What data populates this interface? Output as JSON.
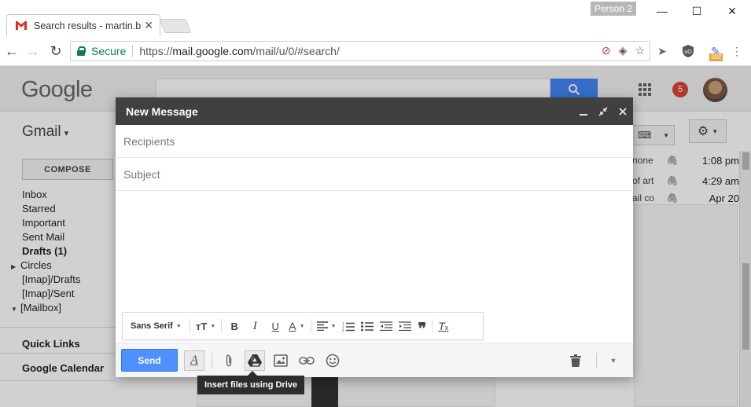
{
  "browser": {
    "tab_title": "Search results - martin.b",
    "person_label": "Person 2",
    "secure_label": "Secure",
    "url_scheme": "https://",
    "url_host": "mail.google.com",
    "url_path": "/mail/u/0/#search/",
    "extension_badge": "302"
  },
  "gmail": {
    "logo": "Google",
    "label": "Gmail",
    "compose_label": "COMPOSE",
    "notification_count": "5",
    "sidebar": [
      "Inbox",
      "Starred",
      "Important",
      "Sent Mail",
      "Drafts (1)",
      "Circles",
      "[Imap]/Drafts",
      "[Imap]/Sent",
      "[Mailbox]"
    ],
    "quick_links": "Quick Links",
    "google_calendar": "Google Calendar",
    "mail_rows": [
      {
        "snippet": "none",
        "time": "1:08 pm"
      },
      {
        "snippet": "of art",
        "time": "4:29 am"
      },
      {
        "snippet": "ail co",
        "time": "Apr 20"
      }
    ]
  },
  "compose": {
    "title": "New Message",
    "recipients_placeholder": "Recipients",
    "subject_placeholder": "Subject",
    "font_label": "Sans Serif",
    "send_label": "Send",
    "tooltip": "Insert files using Drive"
  },
  "colors": {
    "send_blue": "#4d90fe",
    "header_dark": "#404040",
    "secure_green": "#0b8043",
    "notif_red": "#db4437"
  }
}
